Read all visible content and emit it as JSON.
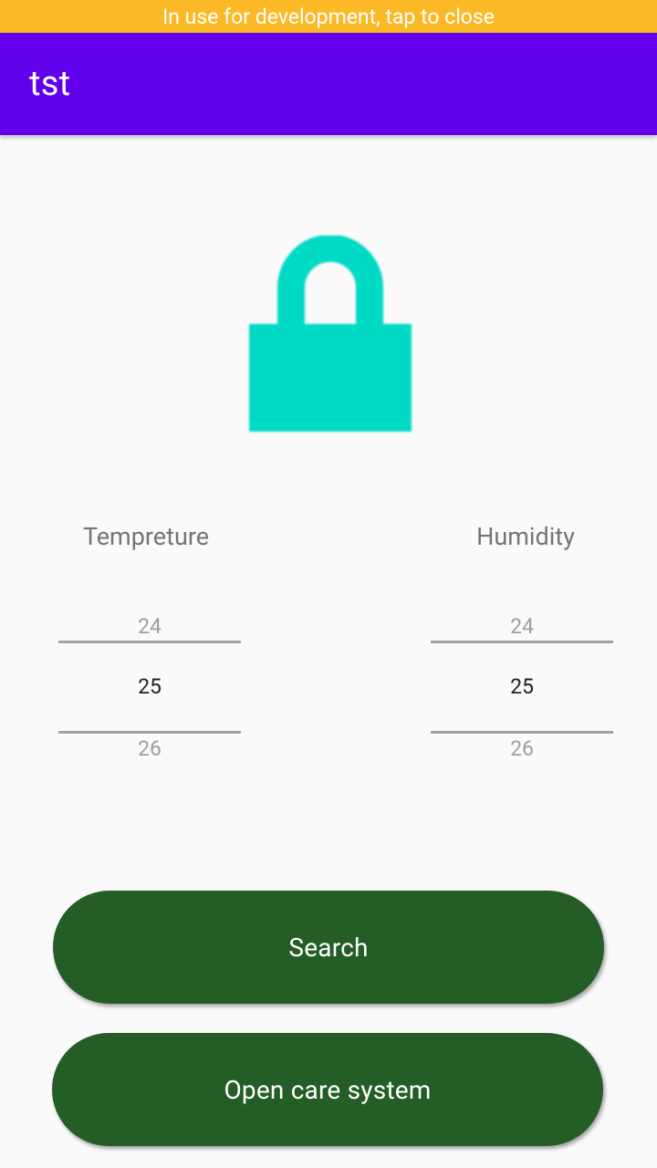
{
  "dev_banner": {
    "text": "In use for development, tap to close"
  },
  "app_bar": {
    "title": "tst",
    "color": "#6200ee"
  },
  "lock": {
    "icon": "lock-icon",
    "color": "#00dac5"
  },
  "pickers": {
    "temperature": {
      "label": "Tempreture",
      "prev": "24",
      "current": "25",
      "next": "26"
    },
    "humidity": {
      "label": "Humidity",
      "prev": "24",
      "current": "25",
      "next": "26"
    }
  },
  "buttons": {
    "search_label": "Search",
    "care_label": "Open care system",
    "color": "#245e26"
  }
}
